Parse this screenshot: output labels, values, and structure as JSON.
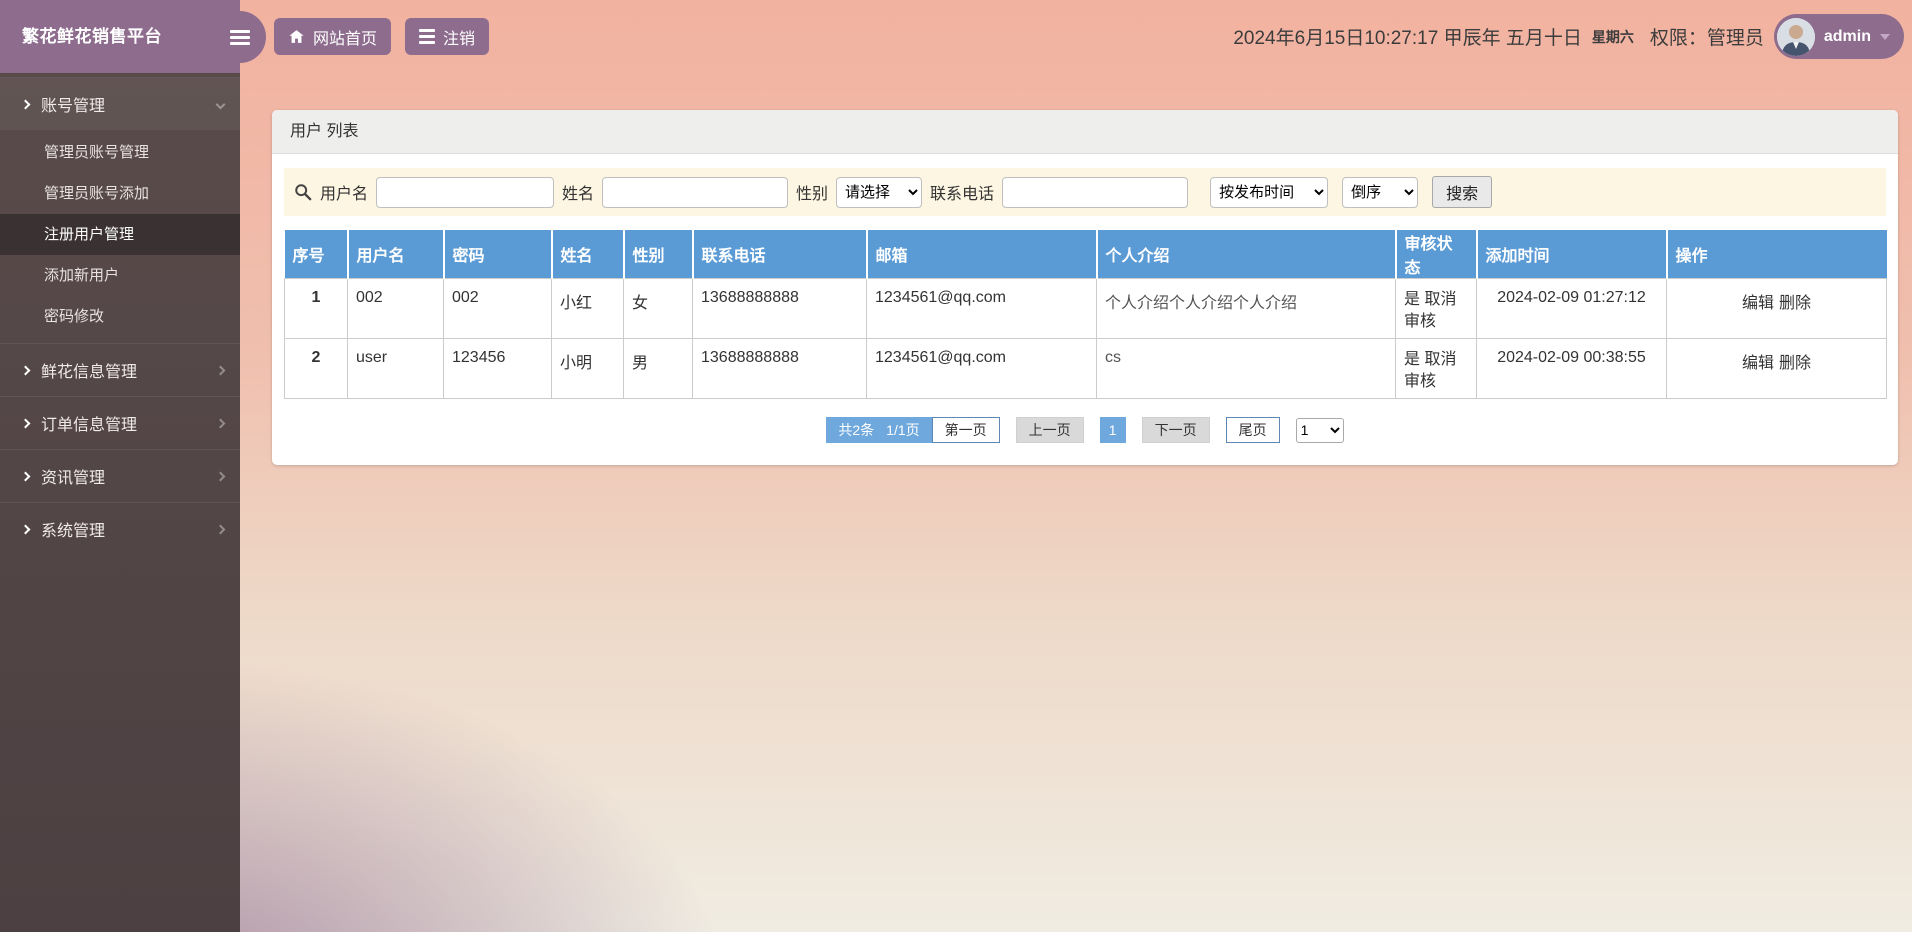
{
  "app": {
    "title": "繁花鲜花销售平台"
  },
  "topbar": {
    "home": "网站首页",
    "logout": "注销",
    "datetime": "2024年6月15日10:27:17 甲辰年 五月十日",
    "weekday": "星期六",
    "role": "权限：管理员",
    "username": "admin"
  },
  "sidebar": {
    "sections": [
      {
        "label": "账号管理",
        "children": [
          "管理员账号管理",
          "管理员账号添加",
          "注册用户管理",
          "添加新用户",
          "密码修改"
        ]
      },
      {
        "label": "鲜花信息管理"
      },
      {
        "label": "订单信息管理"
      },
      {
        "label": "资讯管理"
      },
      {
        "label": "系统管理"
      }
    ]
  },
  "panel": {
    "title": "用户 列表",
    "search": {
      "username_label": "用户名",
      "name_label": "姓名",
      "gender_label": "性别",
      "gender_option": "请选择",
      "phone_label": "联系电话",
      "sort_field_option": "按发布时间",
      "sort_order_option": "倒序",
      "submit": "搜索"
    },
    "table": {
      "headers": [
        "序号",
        "用户名",
        "密码",
        "姓名",
        "性别",
        "联系电话",
        "邮箱",
        "个人介绍",
        "审核状态",
        "添加时间",
        "操作"
      ],
      "rows": [
        {
          "no": "1",
          "username": "002",
          "password": "002",
          "name": "小红",
          "gender": "女",
          "phone": "13688888888",
          "email": "1234561@qq.com",
          "intro": "个人介绍个人介绍个人介绍",
          "audit_status": "是",
          "audit_action": "取消审核",
          "time": "2024-02-09 01:27:12",
          "edit": "编辑",
          "del": "删除"
        },
        {
          "no": "2",
          "username": "user",
          "password": "123456",
          "name": "小明",
          "gender": "男",
          "phone": "13688888888",
          "email": "1234561@qq.com",
          "intro": "cs",
          "audit_status": "是",
          "audit_action": "取消审核",
          "time": "2024-02-09 00:38:55",
          "edit": "编辑",
          "del": "删除"
        }
      ]
    },
    "pagination": {
      "total": "共2条",
      "page": "1/1页",
      "first": "第一页",
      "prev": "上一页",
      "current": "1",
      "next": "下一页",
      "last": "尾页",
      "page_select": "1"
    }
  },
  "colors": {
    "accent_purple": "#8d6c8d",
    "table_header_blue": "#5b9bd5",
    "pagination_blue": "#6fa8dc",
    "sidebar_dark": "#4e4243",
    "sidebar_active": "#3a3133",
    "search_bg": "#fdf6e2",
    "topbar_pink": "#f1b4a3"
  }
}
